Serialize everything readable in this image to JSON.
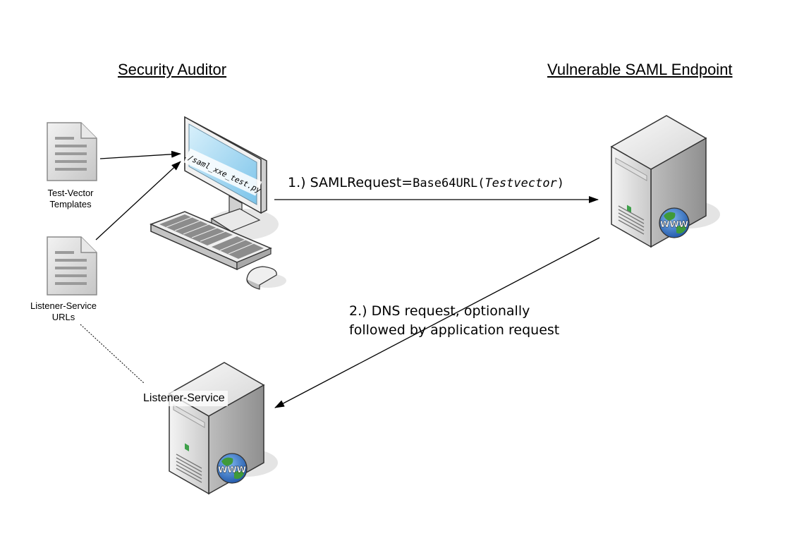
{
  "headers": {
    "auditor": "Security Auditor",
    "endpoint": "Vulnerable SAML Endpoint"
  },
  "docs": {
    "templates": [
      "Test-Vector",
      "Templates"
    ],
    "listener_urls": [
      "Listener-Service",
      "URLs"
    ]
  },
  "screen_text": "./saml_xxe_test.py",
  "step1": {
    "prefix": "1.)  SAMLRequest=",
    "func": "Base64URL(",
    "arg": "Testvector",
    "suffix": ")"
  },
  "step2": {
    "line1": "2.) DNS  request, optionally",
    "line2": "followed by application request"
  },
  "listener_label": "Listener-Service",
  "server_badge": "WWW",
  "colors": {
    "line": "#000000",
    "server_gray": "#d9d9d9",
    "screen_blue": "#a9d8f0",
    "globe_blue": "#2a6fc9",
    "globe_green": "#3f9a3a"
  }
}
